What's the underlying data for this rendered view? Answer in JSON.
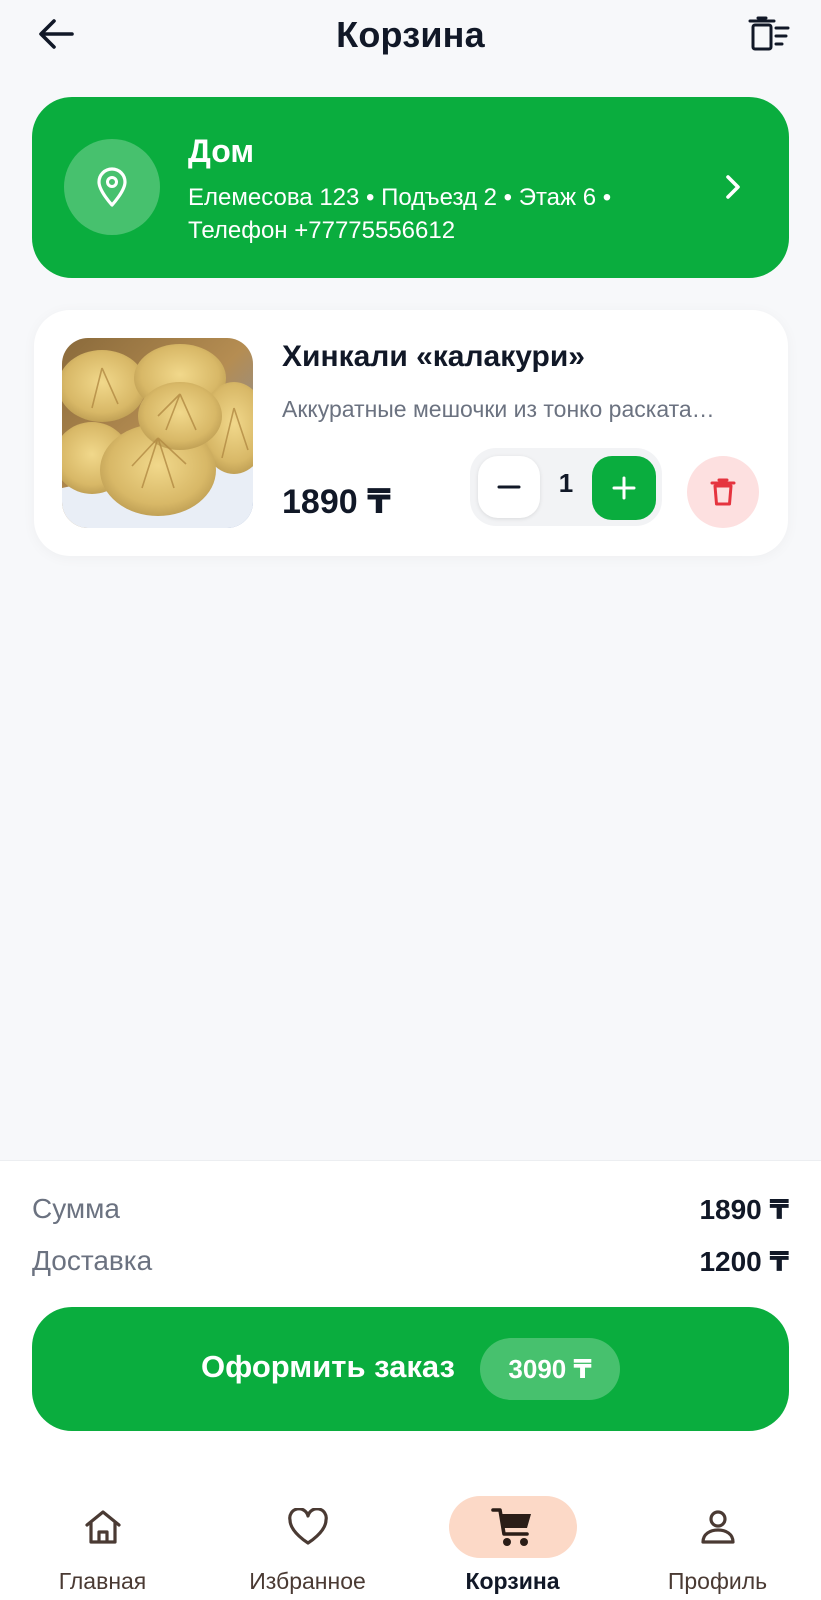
{
  "header": {
    "title": "Корзина",
    "back_icon": "arrow-left-icon",
    "clear_icon": "clear-cart-icon"
  },
  "address": {
    "name": "Дом",
    "details": "Елемесова 123 • Подъезд 2 • Этаж 6 • Телефон +77775556612",
    "icon": "location-pin-icon",
    "chevron_icon": "chevron-right-icon"
  },
  "cart_items": [
    {
      "name": "Хинкали «калакури»",
      "description": "Аккуратные мешочки из тонко раската…",
      "price": "1890 ₸",
      "quantity": "1",
      "image": "khinkali-photo"
    }
  ],
  "summary": {
    "subtotal_label": "Сумма",
    "subtotal_value": "1890 ₸",
    "delivery_label": "Доставка",
    "delivery_value": "1200 ₸"
  },
  "checkout": {
    "label": "Оформить заказ",
    "total": "3090 ₸"
  },
  "nav": {
    "items": [
      {
        "label": "Главная",
        "icon": "home-icon",
        "active": false
      },
      {
        "label": "Избранное",
        "icon": "heart-icon",
        "active": false
      },
      {
        "label": "Корзина",
        "icon": "cart-icon",
        "active": true
      },
      {
        "label": "Профиль",
        "icon": "profile-icon",
        "active": false
      }
    ]
  },
  "colors": {
    "accent_green": "#0aad3e",
    "background": "#f7f8fa",
    "remove_bg": "#fde0e0",
    "remove_icon": "#e5343f",
    "active_nav_bg": "#fcd9c7"
  }
}
